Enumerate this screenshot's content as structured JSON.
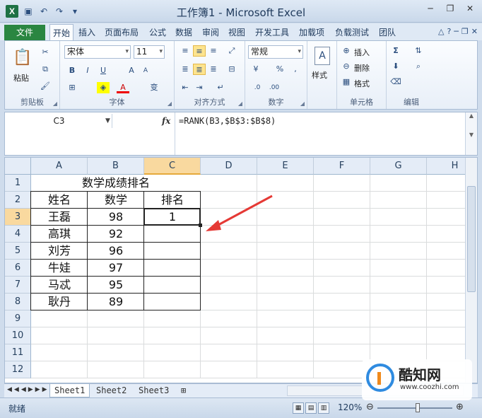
{
  "window": {
    "title": "工作簿1 - Microsoft Excel",
    "app_icon": "X",
    "qat_icons": [
      "save-icon",
      "undo-icon",
      "redo-icon",
      "customize-icon"
    ],
    "controls": [
      "minimize",
      "restore",
      "close"
    ]
  },
  "ribbon": {
    "file_tab": "文件",
    "tabs": [
      "开始",
      "插入",
      "页面布局",
      "公式",
      "数据",
      "审阅",
      "视图",
      "开发工具",
      "加载项",
      "负载测试",
      "团队"
    ],
    "active_tab": "开始",
    "clipboard": {
      "paste": "粘贴",
      "label": "剪贴板"
    },
    "font": {
      "name": "宋体",
      "size": "11",
      "bold": "B",
      "italic": "I",
      "underline": "U",
      "grow": "A",
      "shrink": "A",
      "wen": "变",
      "label": "字体"
    },
    "alignment": {
      "label": "对齐方式"
    },
    "number": {
      "format": "常规",
      "percent": "%",
      "comma": ",",
      "label": "数字"
    },
    "styles": {
      "label": "样式"
    },
    "cells": {
      "insert": "插入",
      "delete": "删除",
      "format": "格式",
      "label": "单元格"
    },
    "editing": {
      "label": "编辑",
      "sum": "Σ"
    }
  },
  "formula_bar": {
    "name_box": "C3",
    "fx": "fx",
    "formula": "=RANK(B3,$B$3:$B$8)"
  },
  "sheet": {
    "columns": [
      "A",
      "B",
      "C",
      "D",
      "E",
      "F",
      "G",
      "H"
    ],
    "rows": [
      "1",
      "2",
      "3",
      "4",
      "5",
      "6",
      "7",
      "8",
      "9",
      "10",
      "11",
      "12"
    ],
    "selected_column": "C",
    "selected_row": "3",
    "title": "数学成绩排名",
    "headers": [
      "姓名",
      "数学",
      "排名"
    ],
    "records": [
      {
        "name": "王磊",
        "score": "98",
        "rank": "1"
      },
      {
        "name": "高琪",
        "score": "92",
        "rank": ""
      },
      {
        "name": "刘芳",
        "score": "96",
        "rank": ""
      },
      {
        "name": "牛娃",
        "score": "97",
        "rank": ""
      },
      {
        "name": "马忒",
        "score": "95",
        "rank": ""
      },
      {
        "name": "耿丹",
        "score": "89",
        "rank": ""
      }
    ],
    "arrow_color": "#e53935"
  },
  "sheet_tabs": [
    "Sheet1",
    "Sheet2",
    "Sheet3"
  ],
  "active_sheet": "Sheet1",
  "status": {
    "text": "就绪",
    "zoom": "120%",
    "zoom_percent": 120
  },
  "watermark": {
    "title": "酷知网",
    "url": "www.coozhi.com"
  }
}
